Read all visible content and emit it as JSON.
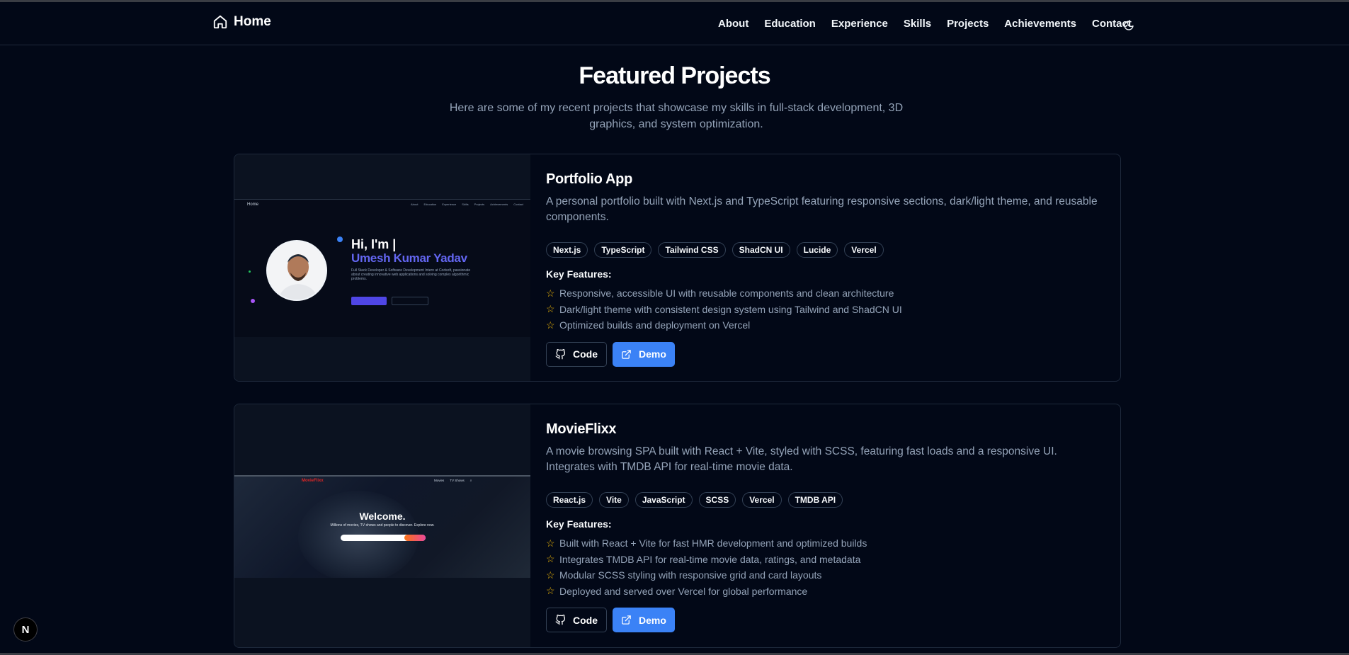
{
  "header": {
    "brand_label": "Home",
    "nav": [
      {
        "label": "About"
      },
      {
        "label": "Education"
      },
      {
        "label": "Experience"
      },
      {
        "label": "Skills"
      },
      {
        "label": "Projects"
      },
      {
        "label": "Achievements"
      },
      {
        "label": "Contact"
      }
    ],
    "theme_icon": "moon-icon"
  },
  "section": {
    "title": "Featured Projects",
    "subtitle": "Here are some of my recent projects that showcase my skills in full-stack development, 3D graphics, and system optimization."
  },
  "projects": [
    {
      "title": "Portfolio App",
      "description": "A personal portfolio built with Next.js and TypeScript featuring responsive sections, dark/light theme, and reusable components.",
      "tags": [
        "Next.js",
        "TypeScript",
        "Tailwind CSS",
        "ShadCN UI",
        "Lucide",
        "Vercel"
      ],
      "key_features_label": "Key Features:",
      "features": [
        "Responsive, accessible UI with reusable components and clean architecture",
        "Dark/light theme with consistent design system using Tailwind and ShadCN UI",
        "Optimized builds and deployment on Vercel"
      ],
      "code_label": "Code",
      "demo_label": "Demo",
      "preview": {
        "nav_brand": "Home",
        "nav_links": [
          "About",
          "Education",
          "Experience",
          "Skills",
          "Projects",
          "Achievements",
          "Contact"
        ],
        "greeting": "Hi, I'm |",
        "name": "Umesh Kumar Yadav",
        "blurb": "Full Stack Developer & Software Development Intern at Codsoft, passionate about creating innovative web applications and solving complex algorithmic problems."
      }
    },
    {
      "title": "MovieFlixx",
      "description": "A movie browsing SPA built with React + Vite, styled with SCSS, featuring fast loads and a responsive UI. Integrates with TMDB API for real-time movie data.",
      "tags": [
        "React.js",
        "Vite",
        "JavaScript",
        "SCSS",
        "Vercel",
        "TMDB API"
      ],
      "key_features_label": "Key Features:",
      "features": [
        "Built with React + Vite for fast HMR development and optimized builds",
        "Integrates TMDB API for real-time movie data, ratings, and metadata",
        "Modular SCSS styling with responsive grid and card layouts",
        "Deployed and served over Vercel for global performance"
      ],
      "code_label": "Code",
      "demo_label": "Demo",
      "preview": {
        "logo": "MovieFlixx",
        "nav_links": [
          "Movies",
          "TV Shows"
        ],
        "welcome": "Welcome.",
        "tagline": "Millions of movies, TV shows and people to discover. Explore now.",
        "search_button": "Search"
      }
    }
  ],
  "next_badge": "N"
}
